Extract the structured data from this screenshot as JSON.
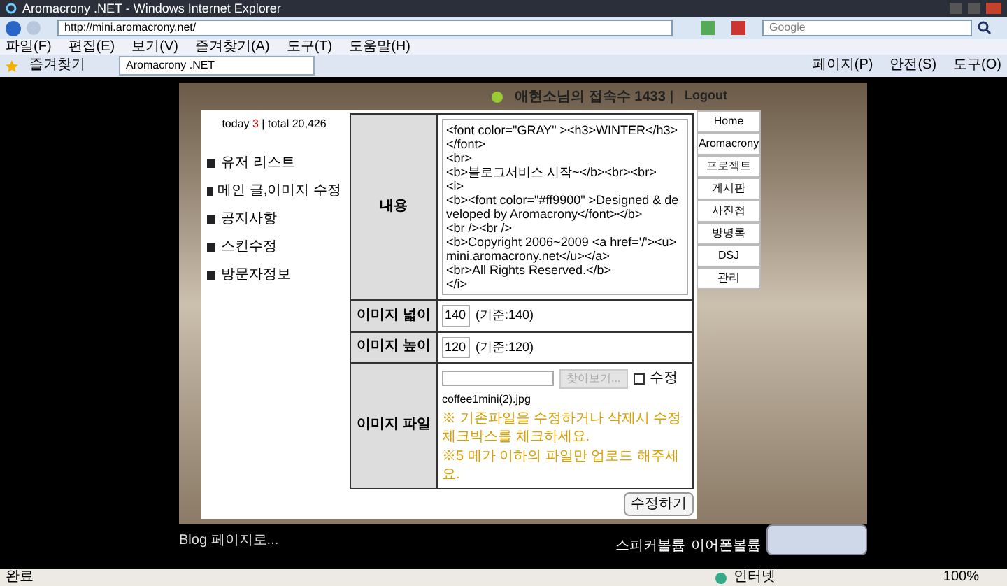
{
  "browser": {
    "title": "Aromacrony .NET - Windows Internet Explorer",
    "address": "http://mini.aromacrony.net/",
    "search_placeholder": "Google",
    "menu": [
      "파일(F)",
      "편집(E)",
      "보기(V)",
      "즐겨찾기(A)",
      "도구(T)",
      "도움말(H)"
    ],
    "favorites": "즐겨찾기",
    "tab": "Aromacrony .NET",
    "toolbar": [
      "페이지(P)",
      "안전(S)",
      "도구(O)"
    ],
    "status": {
      "text": "완료",
      "zone": "인터넷",
      "zoom": "100%"
    }
  },
  "page": {
    "header": {
      "visitors": "애현소님의 접속수 1433 |",
      "logout": "Logout"
    },
    "counter": {
      "today": "today",
      "today_count": "3",
      "total": "| total 20,426"
    },
    "admin_menu": [
      "유저 리스트",
      "메인 글,이미지 수정",
      "공지사항",
      "스킨수정",
      "방문자정보"
    ],
    "form": {
      "content_label": "내용",
      "content_lines": [
        "<font color=\"GRAY\" ><h3>WINTER</h3></font>",
        "<br>",
        "<b>블로그서비스 시작~</b><br><br>",
        "<i>",
        "<b><font color=\"#ff9900\" >Designed & developed by Aromacrony</font></b>",
        "<br /><br />",
        "<b>Copyright 2006~2009 <a href='/'><u>mini.aromacrony.net</u></a>",
        "<br>All Rights Reserved.</b>",
        "</i>"
      ],
      "size_rows": [
        {
          "label": "이미지 넓이",
          "value": "140",
          "hint": "(기준:140)"
        },
        {
          "label": "이미지 높이",
          "value": "120",
          "hint": "(기준:120)"
        }
      ],
      "file": {
        "label": "이미지 파일",
        "browse": "찾아보기...",
        "checkbox": {
          "label": "수정",
          "checked": false
        },
        "filename": "coffee1mini(2).jpg",
        "notes": [
          "※ 기존파일을 수정하거나 삭제시 수정체크박스를 체크하세요.",
          "※5 메가 이하의 파일만 업로드 해주세요."
        ]
      },
      "submit": "수정하기"
    },
    "nav": [
      {
        "label": "Home"
      },
      {
        "label": "Aromacrony"
      },
      {
        "label": "프로젝트"
      },
      {
        "label": "게시판"
      },
      {
        "label": "사진첩"
      },
      {
        "label": "방명록"
      },
      {
        "label": "DSJ"
      },
      {
        "label": "관리"
      }
    ],
    "footer": {
      "blog_link": "Blog 페이지로...",
      "volume_labels": [
        "스피커볼륨",
        "이어폰볼륨"
      ]
    }
  }
}
